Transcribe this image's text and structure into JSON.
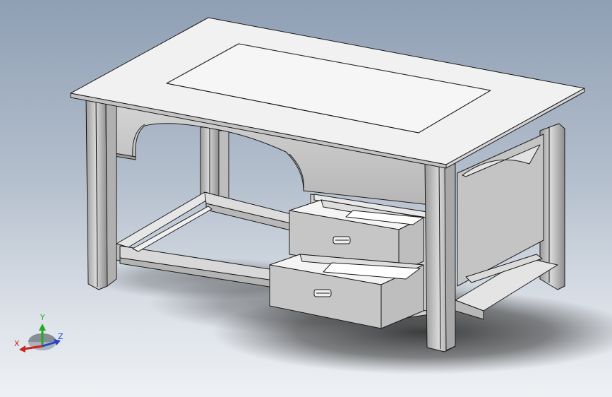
{
  "viewport": {
    "background_top": "#8f9fb4",
    "background_bottom": "#eef1f4"
  },
  "model": {
    "part_fill": "#eeeeee",
    "part_shade": "#c8c8c8",
    "part_dark": "#a9a9a9",
    "edge_color": "#1a1a1a",
    "shadow_color": "#303030"
  },
  "triad": {
    "x_label": "X",
    "y_label": "Y",
    "z_label": "Z",
    "x_color": "#cc2222",
    "y_color": "#22aa22",
    "z_color": "#2244cc",
    "icon": "coordinate-triad-icon"
  }
}
